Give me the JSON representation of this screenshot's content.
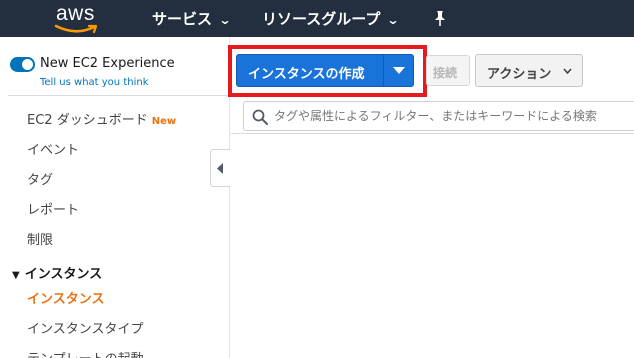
{
  "topbar": {
    "logo_text": "aws",
    "services_label": "サービス",
    "resource_groups_label": "リソースグループ",
    "chevron_icon": "chevron-down-icon",
    "pin_icon": "pin-icon",
    "background": "#232f3e"
  },
  "sidebar": {
    "experience_title": "New EC2 Experience",
    "experience_subtitle": "Tell us what you think",
    "toggle_state": "on",
    "items": [
      {
        "label": "EC2 ダッシュボード",
        "badge": "New"
      },
      {
        "label": "イベント"
      },
      {
        "label": "タグ"
      },
      {
        "label": "レポート"
      },
      {
        "label": "制限"
      }
    ],
    "section": {
      "title": "インスタンス",
      "items": [
        {
          "label": "インスタンス",
          "active": true
        },
        {
          "label": "インスタンスタイプ"
        },
        {
          "label": "テンプレートの起動"
        }
      ]
    }
  },
  "toolbar": {
    "launch_label": "インスタンスの作成",
    "connect_label": "接続",
    "actions_label": "アクション"
  },
  "search": {
    "placeholder": "タグや属性によるフィルター、またはキーワードによる検索",
    "value": ""
  },
  "colors": {
    "primary": "#1a73d9",
    "accent_orange": "#ec7211",
    "highlight_red": "#e5191e",
    "link_blue": "#0073bb"
  }
}
